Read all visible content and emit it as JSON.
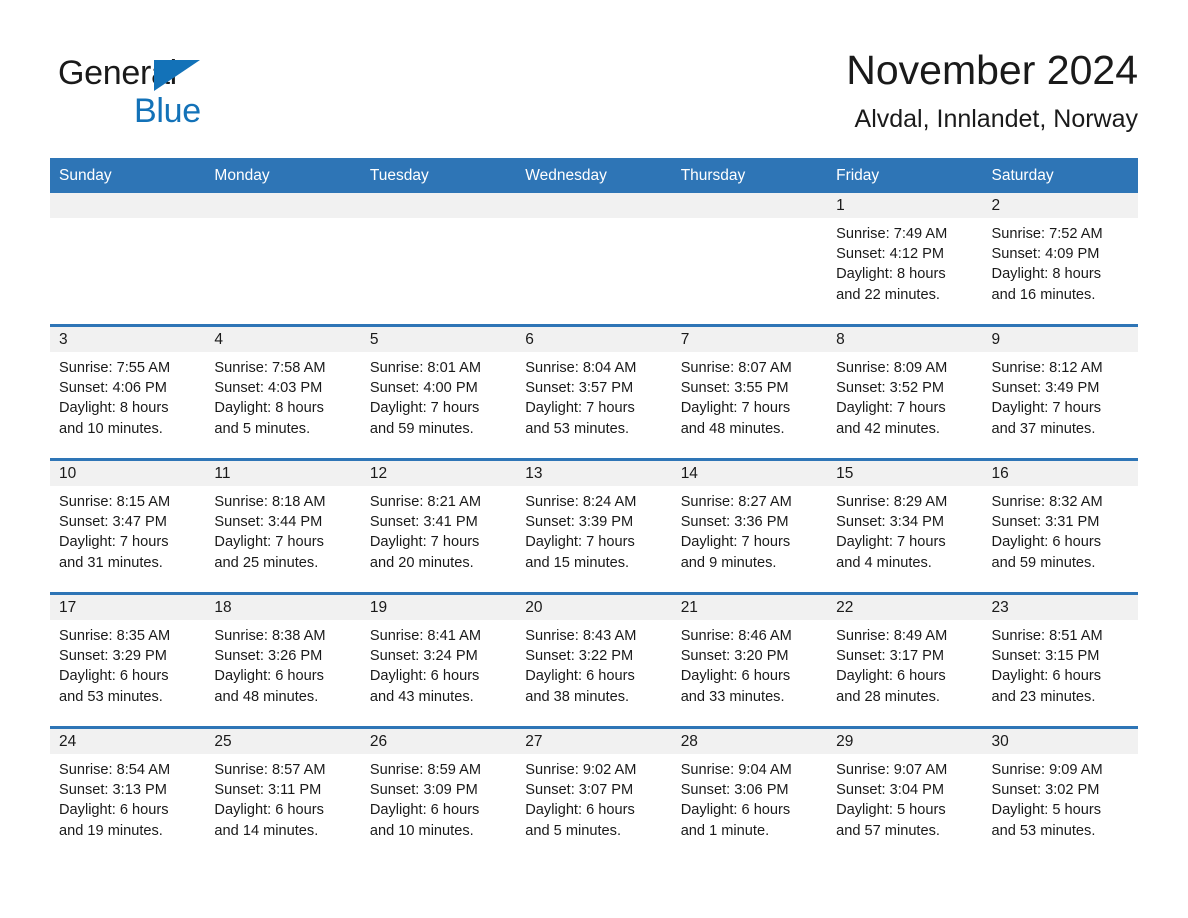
{
  "brand": {
    "logo_line1": "General",
    "logo_line2": "Blue",
    "logo_triangle_color": "#1372b8",
    "accent_color": "#2e75b6"
  },
  "header": {
    "title": "November 2024",
    "subtitle": "Alvdal, Innlandet, Norway"
  },
  "weekday_headers": [
    "Sunday",
    "Monday",
    "Tuesday",
    "Wednesday",
    "Thursday",
    "Friday",
    "Saturday"
  ],
  "weeks": [
    [
      {
        "day": "",
        "sunrise": "",
        "sunset": "",
        "daylight_line1": "",
        "daylight_line2": ""
      },
      {
        "day": "",
        "sunrise": "",
        "sunset": "",
        "daylight_line1": "",
        "daylight_line2": ""
      },
      {
        "day": "",
        "sunrise": "",
        "sunset": "",
        "daylight_line1": "",
        "daylight_line2": ""
      },
      {
        "day": "",
        "sunrise": "",
        "sunset": "",
        "daylight_line1": "",
        "daylight_line2": ""
      },
      {
        "day": "",
        "sunrise": "",
        "sunset": "",
        "daylight_line1": "",
        "daylight_line2": ""
      },
      {
        "day": "1",
        "sunrise": "Sunrise: 7:49 AM",
        "sunset": "Sunset: 4:12 PM",
        "daylight_line1": "Daylight: 8 hours",
        "daylight_line2": "and 22 minutes."
      },
      {
        "day": "2",
        "sunrise": "Sunrise: 7:52 AM",
        "sunset": "Sunset: 4:09 PM",
        "daylight_line1": "Daylight: 8 hours",
        "daylight_line2": "and 16 minutes."
      }
    ],
    [
      {
        "day": "3",
        "sunrise": "Sunrise: 7:55 AM",
        "sunset": "Sunset: 4:06 PM",
        "daylight_line1": "Daylight: 8 hours",
        "daylight_line2": "and 10 minutes."
      },
      {
        "day": "4",
        "sunrise": "Sunrise: 7:58 AM",
        "sunset": "Sunset: 4:03 PM",
        "daylight_line1": "Daylight: 8 hours",
        "daylight_line2": "and 5 minutes."
      },
      {
        "day": "5",
        "sunrise": "Sunrise: 8:01 AM",
        "sunset": "Sunset: 4:00 PM",
        "daylight_line1": "Daylight: 7 hours",
        "daylight_line2": "and 59 minutes."
      },
      {
        "day": "6",
        "sunrise": "Sunrise: 8:04 AM",
        "sunset": "Sunset: 3:57 PM",
        "daylight_line1": "Daylight: 7 hours",
        "daylight_line2": "and 53 minutes."
      },
      {
        "day": "7",
        "sunrise": "Sunrise: 8:07 AM",
        "sunset": "Sunset: 3:55 PM",
        "daylight_line1": "Daylight: 7 hours",
        "daylight_line2": "and 48 minutes."
      },
      {
        "day": "8",
        "sunrise": "Sunrise: 8:09 AM",
        "sunset": "Sunset: 3:52 PM",
        "daylight_line1": "Daylight: 7 hours",
        "daylight_line2": "and 42 minutes."
      },
      {
        "day": "9",
        "sunrise": "Sunrise: 8:12 AM",
        "sunset": "Sunset: 3:49 PM",
        "daylight_line1": "Daylight: 7 hours",
        "daylight_line2": "and 37 minutes."
      }
    ],
    [
      {
        "day": "10",
        "sunrise": "Sunrise: 8:15 AM",
        "sunset": "Sunset: 3:47 PM",
        "daylight_line1": "Daylight: 7 hours",
        "daylight_line2": "and 31 minutes."
      },
      {
        "day": "11",
        "sunrise": "Sunrise: 8:18 AM",
        "sunset": "Sunset: 3:44 PM",
        "daylight_line1": "Daylight: 7 hours",
        "daylight_line2": "and 25 minutes."
      },
      {
        "day": "12",
        "sunrise": "Sunrise: 8:21 AM",
        "sunset": "Sunset: 3:41 PM",
        "daylight_line1": "Daylight: 7 hours",
        "daylight_line2": "and 20 minutes."
      },
      {
        "day": "13",
        "sunrise": "Sunrise: 8:24 AM",
        "sunset": "Sunset: 3:39 PM",
        "daylight_line1": "Daylight: 7 hours",
        "daylight_line2": "and 15 minutes."
      },
      {
        "day": "14",
        "sunrise": "Sunrise: 8:27 AM",
        "sunset": "Sunset: 3:36 PM",
        "daylight_line1": "Daylight: 7 hours",
        "daylight_line2": "and 9 minutes."
      },
      {
        "day": "15",
        "sunrise": "Sunrise: 8:29 AM",
        "sunset": "Sunset: 3:34 PM",
        "daylight_line1": "Daylight: 7 hours",
        "daylight_line2": "and 4 minutes."
      },
      {
        "day": "16",
        "sunrise": "Sunrise: 8:32 AM",
        "sunset": "Sunset: 3:31 PM",
        "daylight_line1": "Daylight: 6 hours",
        "daylight_line2": "and 59 minutes."
      }
    ],
    [
      {
        "day": "17",
        "sunrise": "Sunrise: 8:35 AM",
        "sunset": "Sunset: 3:29 PM",
        "daylight_line1": "Daylight: 6 hours",
        "daylight_line2": "and 53 minutes."
      },
      {
        "day": "18",
        "sunrise": "Sunrise: 8:38 AM",
        "sunset": "Sunset: 3:26 PM",
        "daylight_line1": "Daylight: 6 hours",
        "daylight_line2": "and 48 minutes."
      },
      {
        "day": "19",
        "sunrise": "Sunrise: 8:41 AM",
        "sunset": "Sunset: 3:24 PM",
        "daylight_line1": "Daylight: 6 hours",
        "daylight_line2": "and 43 minutes."
      },
      {
        "day": "20",
        "sunrise": "Sunrise: 8:43 AM",
        "sunset": "Sunset: 3:22 PM",
        "daylight_line1": "Daylight: 6 hours",
        "daylight_line2": "and 38 minutes."
      },
      {
        "day": "21",
        "sunrise": "Sunrise: 8:46 AM",
        "sunset": "Sunset: 3:20 PM",
        "daylight_line1": "Daylight: 6 hours",
        "daylight_line2": "and 33 minutes."
      },
      {
        "day": "22",
        "sunrise": "Sunrise: 8:49 AM",
        "sunset": "Sunset: 3:17 PM",
        "daylight_line1": "Daylight: 6 hours",
        "daylight_line2": "and 28 minutes."
      },
      {
        "day": "23",
        "sunrise": "Sunrise: 8:51 AM",
        "sunset": "Sunset: 3:15 PM",
        "daylight_line1": "Daylight: 6 hours",
        "daylight_line2": "and 23 minutes."
      }
    ],
    [
      {
        "day": "24",
        "sunrise": "Sunrise: 8:54 AM",
        "sunset": "Sunset: 3:13 PM",
        "daylight_line1": "Daylight: 6 hours",
        "daylight_line2": "and 19 minutes."
      },
      {
        "day": "25",
        "sunrise": "Sunrise: 8:57 AM",
        "sunset": "Sunset: 3:11 PM",
        "daylight_line1": "Daylight: 6 hours",
        "daylight_line2": "and 14 minutes."
      },
      {
        "day": "26",
        "sunrise": "Sunrise: 8:59 AM",
        "sunset": "Sunset: 3:09 PM",
        "daylight_line1": "Daylight: 6 hours",
        "daylight_line2": "and 10 minutes."
      },
      {
        "day": "27",
        "sunrise": "Sunrise: 9:02 AM",
        "sunset": "Sunset: 3:07 PM",
        "daylight_line1": "Daylight: 6 hours",
        "daylight_line2": "and 5 minutes."
      },
      {
        "day": "28",
        "sunrise": "Sunrise: 9:04 AM",
        "sunset": "Sunset: 3:06 PM",
        "daylight_line1": "Daylight: 6 hours",
        "daylight_line2": "and 1 minute."
      },
      {
        "day": "29",
        "sunrise": "Sunrise: 9:07 AM",
        "sunset": "Sunset: 3:04 PM",
        "daylight_line1": "Daylight: 5 hours",
        "daylight_line2": "and 57 minutes."
      },
      {
        "day": "30",
        "sunrise": "Sunrise: 9:09 AM",
        "sunset": "Sunset: 3:02 PM",
        "daylight_line1": "Daylight: 5 hours",
        "daylight_line2": "and 53 minutes."
      }
    ]
  ]
}
